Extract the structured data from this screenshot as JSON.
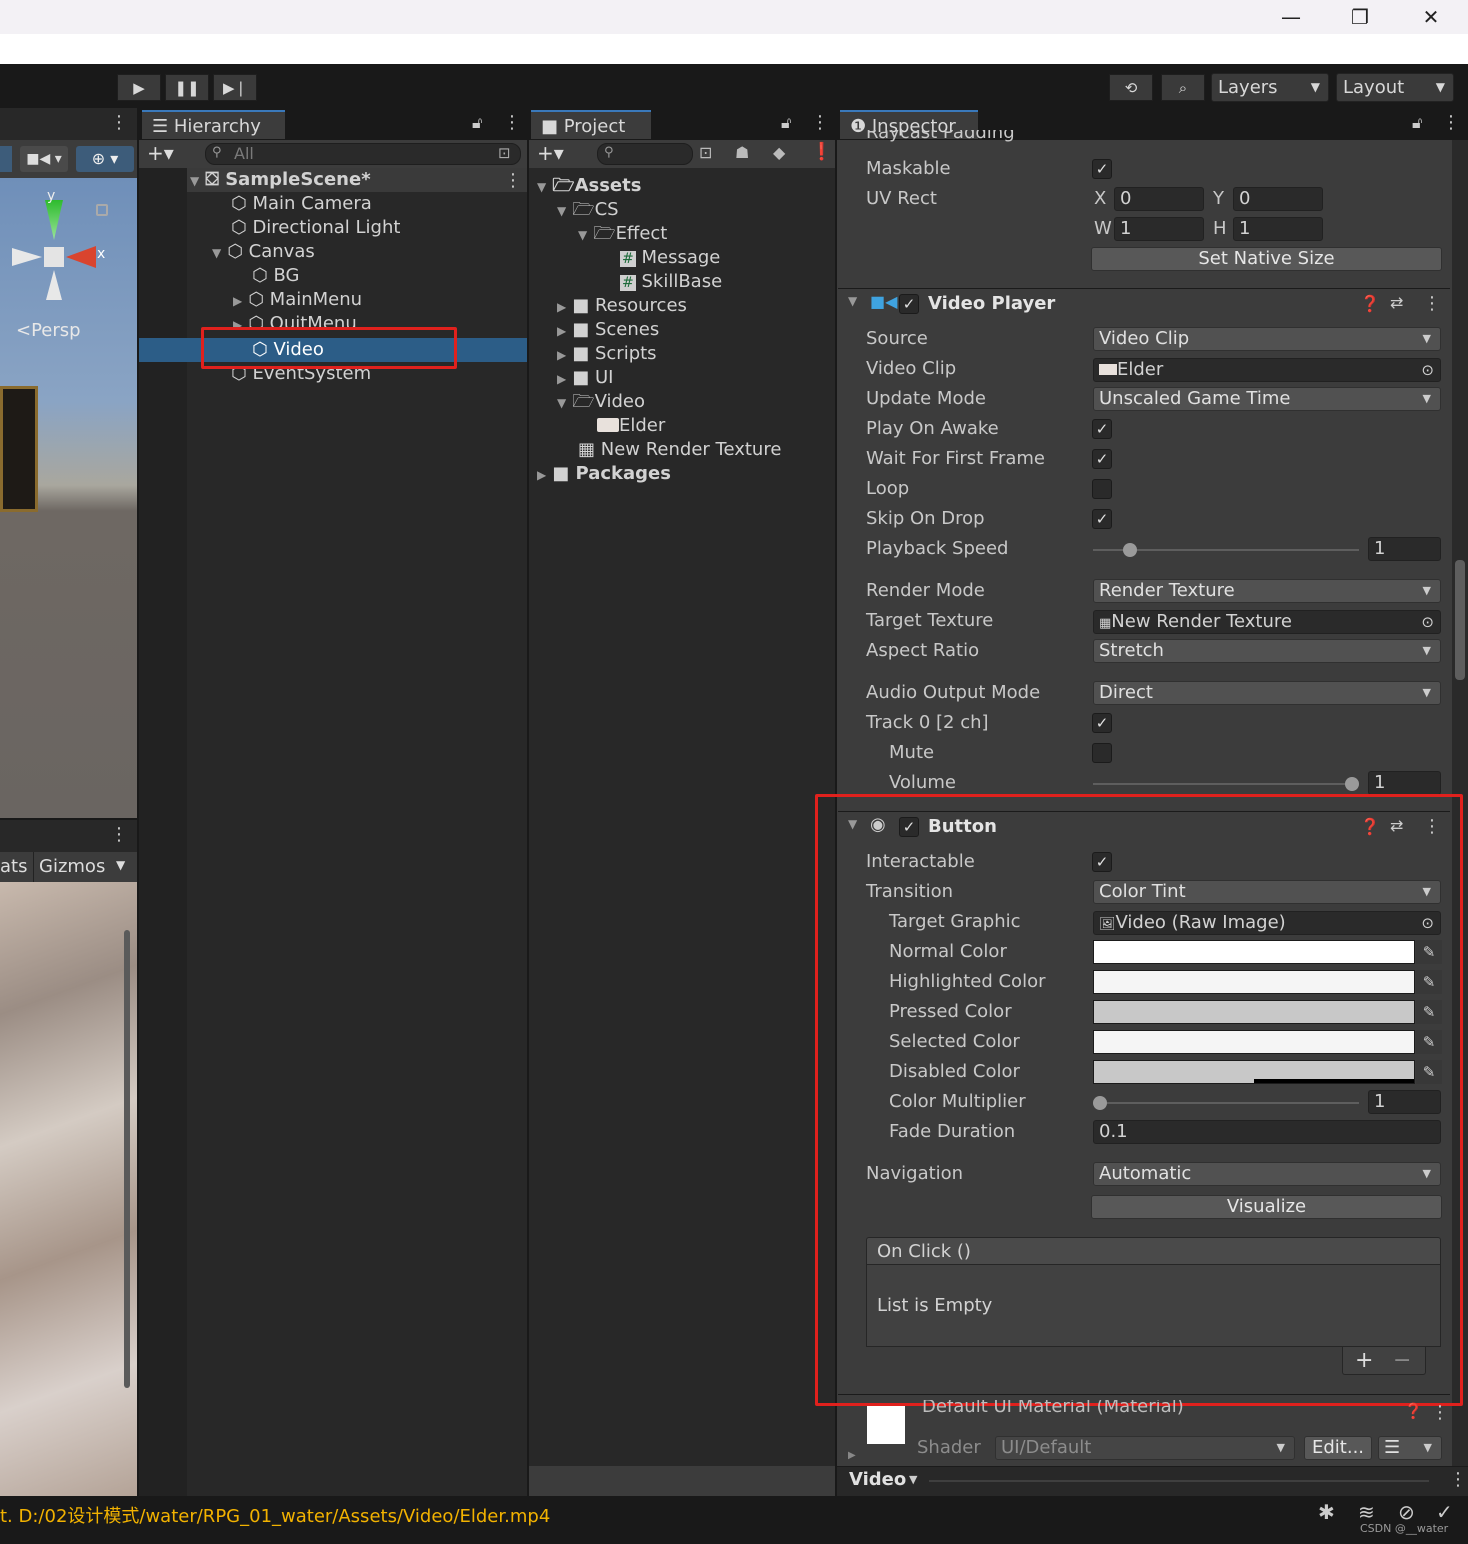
{
  "window": {
    "minimize": "—",
    "maximize": "❐",
    "close": "✕"
  },
  "toolbar": {
    "play": "▶",
    "pause": "❚❚",
    "step": "▶❘",
    "history_icon": "⟲",
    "search_icon": "⌕",
    "layers": "Layers",
    "layout": "Layout"
  },
  "scene": {
    "persp_label": "<Persp",
    "y_axis": "y",
    "x_axis": "x",
    "gizmos_prefix": "ats",
    "gizmos": "Gizmos"
  },
  "hierarchy": {
    "tab": "Hierarchy",
    "search_placeholder": "All",
    "items": [
      {
        "label": "SampleScene*",
        "arrow": "▼"
      },
      {
        "label": "Main Camera",
        "arrow": ""
      },
      {
        "label": "Directional Light",
        "arrow": ""
      },
      {
        "label": "Canvas",
        "arrow": "▼"
      },
      {
        "label": "BG",
        "arrow": ""
      },
      {
        "label": "MainMenu",
        "arrow": "▶"
      },
      {
        "label": "QuitMenu",
        "arrow": "▶"
      },
      {
        "label": "Video",
        "arrow": ""
      },
      {
        "label": "EventSystem",
        "arrow": ""
      }
    ]
  },
  "project": {
    "tab": "Project",
    "items": [
      {
        "label": "Assets",
        "arrow": "▼"
      },
      {
        "label": "CS",
        "arrow": "▼"
      },
      {
        "label": "Effect",
        "arrow": "▼"
      },
      {
        "label": "Message",
        "arrow": ""
      },
      {
        "label": "SkillBase",
        "arrow": ""
      },
      {
        "label": "Resources",
        "arrow": "▶"
      },
      {
        "label": "Scenes",
        "arrow": "▶"
      },
      {
        "label": "Scripts",
        "arrow": "▶"
      },
      {
        "label": "UI",
        "arrow": "▶"
      },
      {
        "label": "Video",
        "arrow": "▼"
      },
      {
        "label": "Elder",
        "arrow": ""
      },
      {
        "label": "New Render Texture",
        "arrow": ""
      },
      {
        "label": "Packages",
        "arrow": "▶"
      }
    ]
  },
  "inspector": {
    "tab": "Inspector",
    "cut_label": "Raycast Padding",
    "maskable": "Maskable",
    "uvrect": "UV Rect",
    "x": "X",
    "x_val": "0",
    "y": "Y",
    "y_val": "0",
    "w": "W",
    "w_val": "1",
    "h": "H",
    "h_val": "1",
    "set_native": "Set Native Size",
    "video_player": {
      "title": "Video Player",
      "rows": {
        "source": "Source",
        "source_val": "Video Clip",
        "clip": "Video Clip",
        "clip_val": "Elder",
        "update": "Update Mode",
        "update_val": "Unscaled Game Time",
        "awake": "Play On Awake",
        "wait": "Wait For First Frame",
        "loop": "Loop",
        "skip": "Skip On Drop",
        "speed": "Playback Speed",
        "speed_val": "1",
        "render": "Render Mode",
        "render_val": "Render Texture",
        "target": "Target Texture",
        "target_val": "New Render Texture",
        "aspect": "Aspect Ratio",
        "aspect_val": "Stretch",
        "audio": "Audio Output Mode",
        "audio_val": "Direct",
        "track": "Track 0 [2 ch]",
        "mute": "Mute",
        "volume": "Volume",
        "volume_val": "1"
      },
      "playback_speed_level": 0.12,
      "volume_level": 1.0
    },
    "button": {
      "title": "Button",
      "rows": {
        "interactable": "Interactable",
        "transition": "Transition",
        "transition_val": "Color Tint",
        "target_graphic": "Target Graphic",
        "target_graphic_val": "Video (Raw Image)",
        "normal": "Normal Color",
        "highlighted": "Highlighted Color",
        "pressed": "Pressed Color",
        "selected": "Selected Color",
        "disabled": "Disabled Color",
        "multiplier": "Color Multiplier",
        "multiplier_val": "1",
        "fade": "Fade Duration",
        "fade_val": "0.1",
        "navigation": "Navigation",
        "navigation_val": "Automatic",
        "visualize": "Visualize",
        "onclick": "On Click ()",
        "empty": "List is Empty",
        "plus": "+",
        "minus": "−"
      },
      "colors": {
        "normal": "#ffffff",
        "highlighted": "#f5f5f5",
        "pressed": "#c8c8c8",
        "selected": "#f5f5f5",
        "disabled": "#c8c8c8"
      },
      "color_multiplier_level": 0.0
    },
    "material": {
      "name": "Default UI Material (Material)",
      "shader_label": "Shader",
      "shader_val": "UI/Default",
      "edit": "Edit..."
    },
    "footer": "Video"
  },
  "statusbar": {
    "path": "t. D:/02设计模式/water/RPG_01_water/Assets/Video/Elder.mp4",
    "watermark": "CSDN @__water"
  },
  "accent": "#3a79bb",
  "highlight": "#e0211d"
}
